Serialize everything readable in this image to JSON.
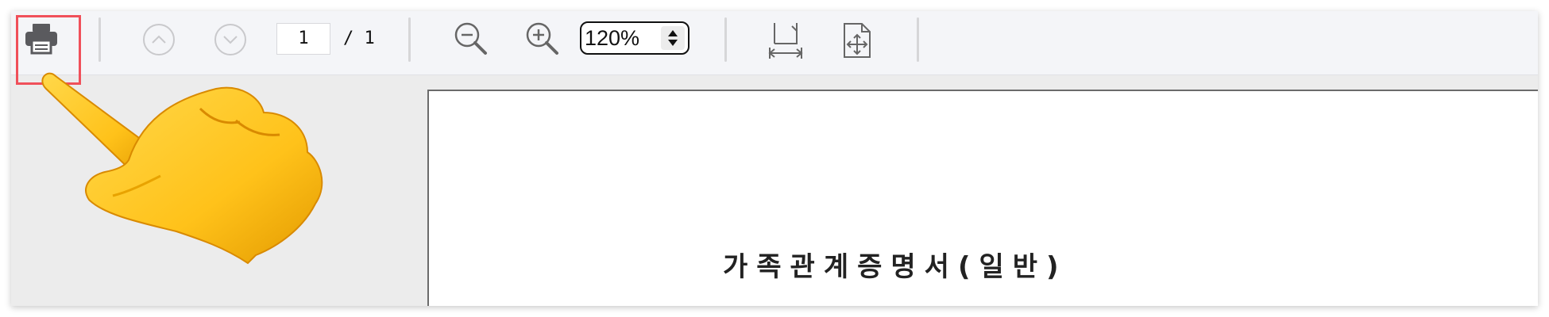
{
  "toolbar": {
    "print": {
      "icon": "printer-icon",
      "highlight_color": "#f0505a"
    },
    "prev_page": {
      "icon": "chevron-up-circle-icon"
    },
    "next_page": {
      "icon": "chevron-down-circle-icon"
    },
    "page_current": "1",
    "page_total": "/ 1",
    "zoom_out": {
      "icon": "zoom-out-icon"
    },
    "zoom_in": {
      "icon": "zoom-in-icon"
    },
    "zoom_value": "120%",
    "fit_width": {
      "icon": "fit-width-icon"
    },
    "fit_page": {
      "icon": "fit-page-icon"
    }
  },
  "document": {
    "title": "가족관계증명서(일반)"
  },
  "overlay": {
    "icon": "pointing-hand-icon"
  }
}
